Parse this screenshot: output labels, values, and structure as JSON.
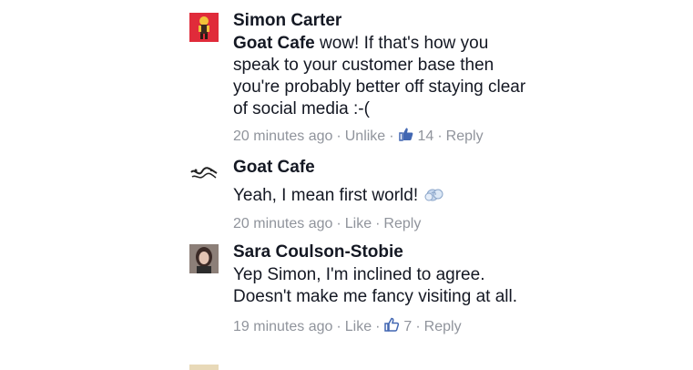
{
  "comments": [
    {
      "author": "Simon Carter",
      "mention": "Goat Cafe",
      "text": " wow! If that's how you speak to your customer base then you're probably better off staying clear of social media :-(",
      "time": "20 minutes ago",
      "action": "Unlike",
      "likes": "14",
      "reply": "Reply",
      "avatar_icon": "red-figure-avatar"
    },
    {
      "author": "Goat Cafe",
      "text": "Yeah, I mean first world!",
      "emoji_icon": "dashing-away-emoji",
      "time": "20 minutes ago",
      "action": "Like",
      "reply": "Reply",
      "avatar_icon": "goat-cafe-logo"
    },
    {
      "author": "Sara Coulson-Stobie",
      "text": "Yep Simon, I'm inclined to agree. Doesn't make me fancy visiting at all.",
      "time": "19 minutes ago",
      "action": "Like",
      "likes": "7",
      "reply": "Reply",
      "avatar_icon": "profile-photo-avatar"
    }
  ],
  "colors": {
    "text": "#141823",
    "meta": "#90949c",
    "like_blue": "#4267b2"
  }
}
